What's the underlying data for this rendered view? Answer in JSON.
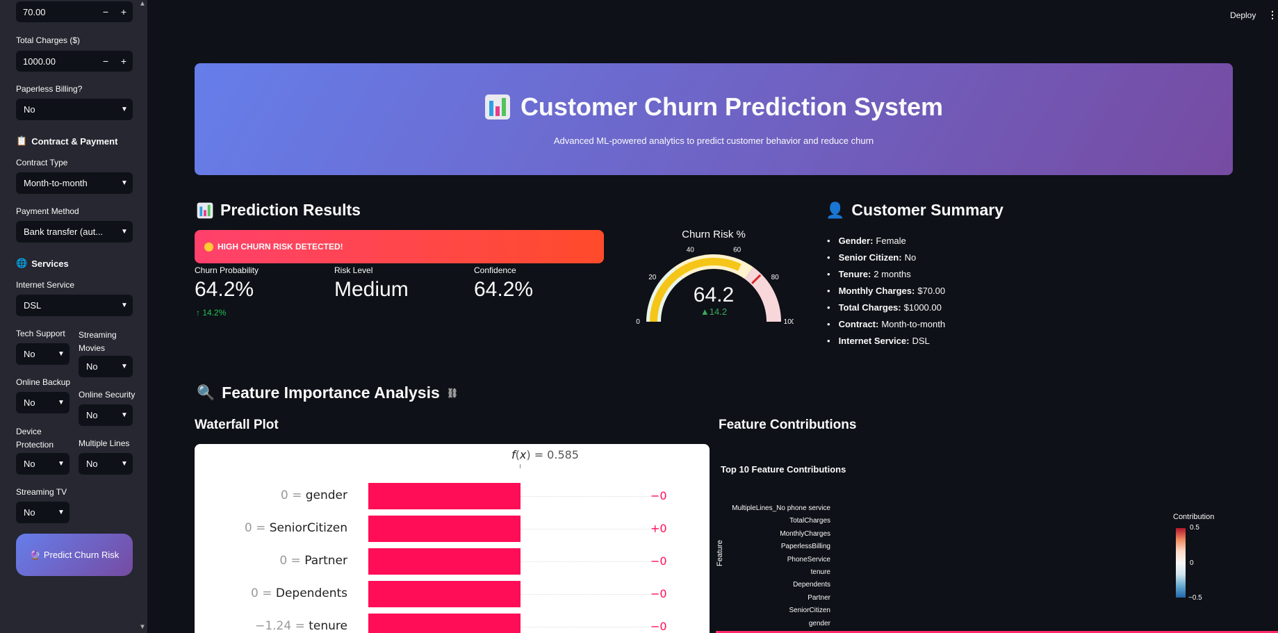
{
  "sidebar": {
    "monthly_charges_value": "70.00",
    "total_charges_label": "Total Charges ($)",
    "total_charges_value": "1000.00",
    "minus": "−",
    "plus": "+",
    "paperless_label": "Paperless Billing?",
    "paperless_value": "No",
    "contract_section": "Contract & Payment",
    "contract_type_label": "Contract Type",
    "contract_type_value": "Month-to-month",
    "payment_method_label": "Payment Method",
    "payment_method_value": "Bank transfer (aut...",
    "services_section": "Services",
    "internet_service_label": "Internet Service",
    "internet_service_value": "DSL",
    "tech_support_label": "Tech Support",
    "tech_support_value": "No",
    "streaming_movies_label": "Streaming Movies",
    "streaming_movies_value": "No",
    "online_backup_label": "Online Backup",
    "online_backup_value": "No",
    "online_security_label": "Online Security",
    "online_security_value": "No",
    "device_protection_label": "Device Protection",
    "device_protection_value": "No",
    "multiple_lines_label": "Multiple Lines",
    "multiple_lines_value": "No",
    "streaming_tv_label": "Streaming TV",
    "streaming_tv_value": "No",
    "predict_button": "Predict Churn Risk"
  },
  "header": {
    "deploy": "Deploy",
    "menu": "⋮"
  },
  "hero": {
    "title": "Customer Churn Prediction System",
    "subtitle": "Advanced ML-powered analytics to predict customer behavior and reduce churn"
  },
  "prediction": {
    "heading": "Prediction Results",
    "alert": "HIGH CHURN RISK DETECTED!",
    "metrics": [
      {
        "label": "Churn Probability",
        "value": "64.2%",
        "delta": "↑ 14.2%"
      },
      {
        "label": "Risk Level",
        "value": "Medium"
      },
      {
        "label": "Confidence",
        "value": "64.2%"
      }
    ]
  },
  "gauge": {
    "title": "Churn Risk %",
    "value": 64.2,
    "value_text": "64.2",
    "delta": "▲14.2",
    "threshold": 75,
    "ticks": [
      "0",
      "20",
      "40",
      "60",
      "80",
      "100"
    ],
    "colors": {
      "bar": "#f5c518",
      "low": "#e8f5e9",
      "mid": "#fff3cd",
      "high": "#f8d7da",
      "threshold": "#d62728"
    }
  },
  "summary": {
    "heading": "Customer Summary",
    "items": [
      {
        "key": "Gender:",
        "value": "Female"
      },
      {
        "key": "Senior Citizen:",
        "value": "No"
      },
      {
        "key": "Tenure:",
        "value": "2 months"
      },
      {
        "key": "Monthly Charges:",
        "value": "$70.00"
      },
      {
        "key": "Total Charges:",
        "value": "$1000.00"
      },
      {
        "key": "Contract:",
        "value": "Month-to-month"
      },
      {
        "key": "Internet Service:",
        "value": "DSL"
      }
    ]
  },
  "features": {
    "heading": "Feature Importance Analysis",
    "link_icon": "⛓",
    "waterfall_heading": "Waterfall Plot",
    "contributions_heading": "Feature Contributions"
  },
  "chart_data": [
    {
      "type": "bar",
      "title": "",
      "fx_label": "= 0.585",
      "rows": [
        {
          "value_label": "0 =",
          "feature": "gender",
          "contribution": "−0"
        },
        {
          "value_label": "0 =",
          "feature": "SeniorCitizen",
          "contribution": "+0"
        },
        {
          "value_label": "0 =",
          "feature": "Partner",
          "contribution": "−0"
        },
        {
          "value_label": "0 =",
          "feature": "Dependents",
          "contribution": "−0"
        },
        {
          "value_label": "−1.24 =",
          "feature": "tenure",
          "contribution": "−0"
        }
      ]
    },
    {
      "type": "heatmap",
      "title": "Top 10 Feature Contributions",
      "ylabel": "Feature",
      "categories": [
        "MultipleLines_No phone service",
        "TotalCharges",
        "MonthlyCharges",
        "PaperlessBilling",
        "PhoneService",
        "tenure",
        "Dependents",
        "Partner",
        "SeniorCitizen",
        "gender"
      ],
      "colorbar": {
        "title": "Contribution",
        "ticks": [
          "0.5",
          "0",
          "−0.5"
        ]
      }
    }
  ]
}
